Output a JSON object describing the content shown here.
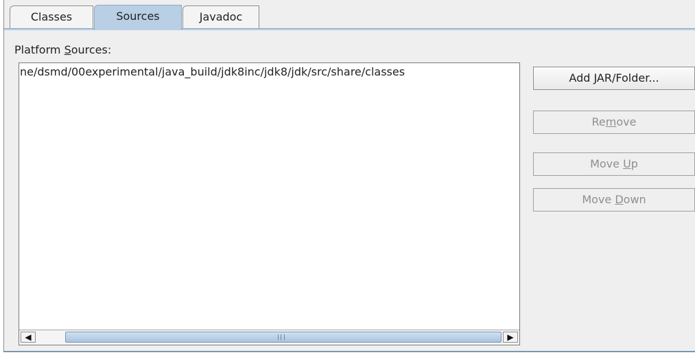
{
  "tabs": [
    {
      "label": "Classes",
      "active": false
    },
    {
      "label": "Sources",
      "active": true
    },
    {
      "label": "Javadoc",
      "active": false
    }
  ],
  "panel": {
    "label_prefix": "Platform ",
    "label_mnemonic": "S",
    "label_suffix": "ources:",
    "list_items": [
      "ne/dsmd/00experimental/java_build/jdk8inc/jdk8/jdk/src/share/classes"
    ]
  },
  "buttons": {
    "add": {
      "prefix": "Add ",
      "mnemonic": "J",
      "suffix": "AR/Folder...",
      "enabled": true
    },
    "remove": {
      "prefix": "Re",
      "mnemonic": "m",
      "suffix": "ove",
      "enabled": false
    },
    "move_up": {
      "prefix": "Move ",
      "mnemonic": "U",
      "suffix": "p",
      "enabled": false
    },
    "move_down": {
      "prefix": "Move ",
      "mnemonic": "D",
      "suffix": "own",
      "enabled": false
    }
  },
  "scrollbar": {
    "left_arrow": "◀",
    "right_arrow": "▶",
    "left_arrow_icon": "left-arrow-icon",
    "right_arrow_icon": "right-arrow-icon"
  },
  "colors": {
    "active_tab": "#b8cfe5",
    "panel_bg": "#efefef",
    "disabled_text": "#8f8f8f"
  }
}
